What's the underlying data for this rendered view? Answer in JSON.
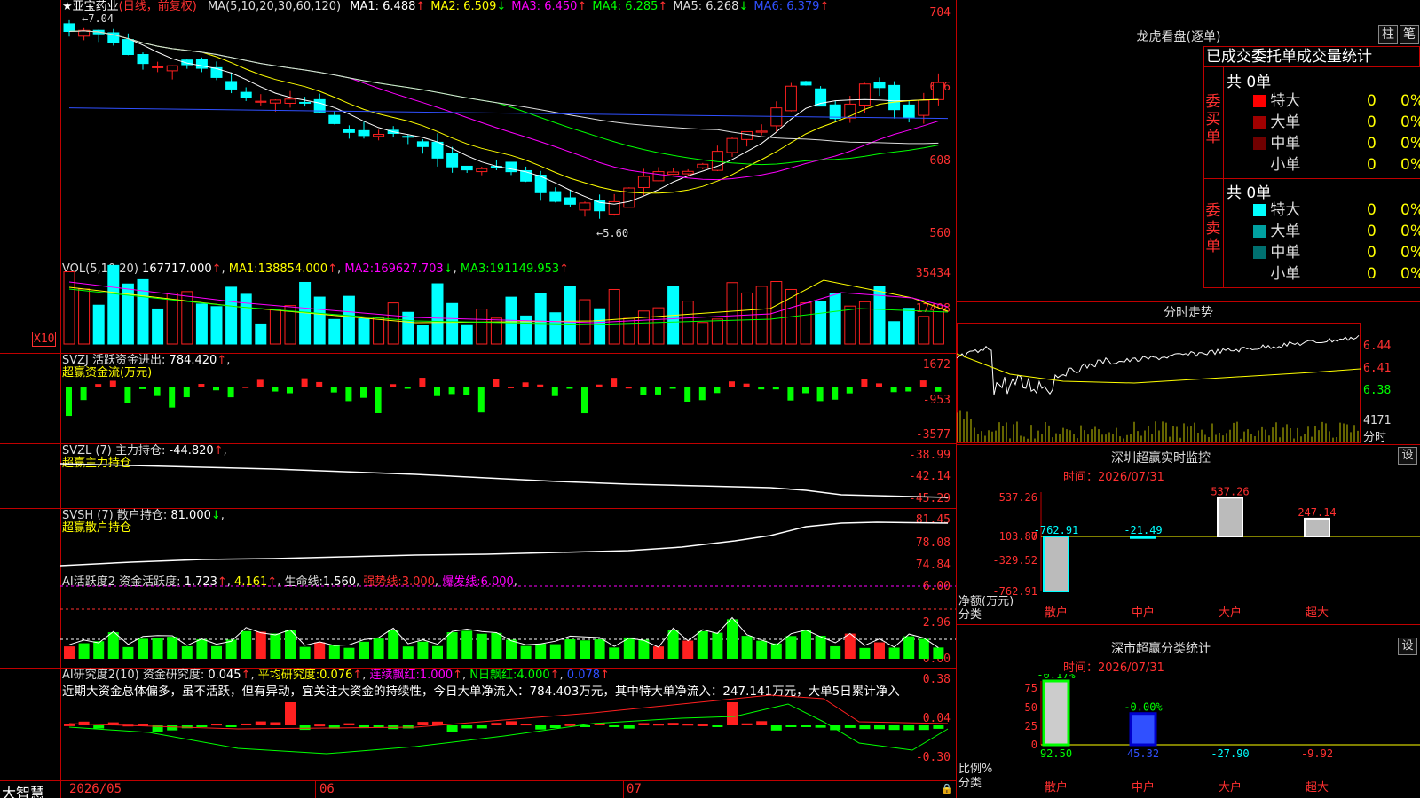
{
  "chart": {
    "title": "★亚宝药业",
    "period": "(日线，前复权)",
    "ma": {
      "params": "MA(5,10,20,30,60,120)",
      "items": [
        {
          "label": "MA1:",
          "value": "6.488",
          "arrow": "↑",
          "color": "#ffffff"
        },
        {
          "label": "MA2:",
          "value": "6.509",
          "arrow": "↓",
          "color": "#ffff00"
        },
        {
          "label": "MA3:",
          "value": "6.450",
          "arrow": "↑",
          "color": "#ff00ff"
        },
        {
          "label": "MA4:",
          "value": "6.285",
          "arrow": "↑",
          "color": "#00ff00"
        },
        {
          "label": "MA5:",
          "value": "6.268",
          "arrow": "↓",
          "color": "#dddddd"
        },
        {
          "label": "MA6:",
          "value": "6.379",
          "arrow": "↑",
          "color": "#3050ff"
        }
      ]
    },
    "price_axis": [
      "704",
      "656",
      "608",
      "560"
    ],
    "high_mark": "←7.04",
    "low_mark": "←5.60",
    "colors": {
      "up": "#ff2020",
      "down": "#00ffff",
      "ma1": "#ffffff",
      "ma2": "#ffff00",
      "ma3": "#ff00ff",
      "ma4": "#00ff00",
      "ma5": "#dddddd",
      "ma6": "#3050ff"
    }
  },
  "vol": {
    "params": "VOL(5,10,20)",
    "value": "167717.000",
    "ma1": {
      "label": "MA1:",
      "value": "138854.000",
      "arrow": "↑"
    },
    "ma2": {
      "label": "MA2:",
      "value": "169627.703",
      "arrow": "↓"
    },
    "ma3": {
      "label": "MA3:",
      "value": "191149.953",
      "arrow": "↑"
    },
    "axis": [
      "35434",
      "17498"
    ],
    "unit": "X10"
  },
  "svzj": {
    "label": "SVZJ 活跃资金进出:",
    "value": "784.420",
    "arrow": "↑",
    "subtitle": "超赢资金流(万元)",
    "axis": [
      "1672",
      "-953",
      "-3577"
    ]
  },
  "svzl": {
    "label": "SVZL (7) 主力持仓:",
    "value": "-44.820",
    "arrow": "↑",
    "subtitle": "超赢主力持仓",
    "axis": [
      "-38.99",
      "-42.14",
      "-45.29"
    ]
  },
  "svsh": {
    "label": "SVSH (7) 散户持仓:",
    "value": "81.000",
    "arrow": "↓",
    "subtitle": "超赢散户持仓",
    "axis": [
      "81.45",
      "78.08",
      "74.84"
    ]
  },
  "ai_active": {
    "label": "AI活跃度2 资金活跃度:",
    "value": "1.723",
    "v2": "4.161",
    "life_label": "生命线:",
    "life_value": "1.560",
    "strong_label": "强势线:",
    "strong_value": "3.000",
    "burst_label": "爆发线:",
    "burst_value": "6.000",
    "axis": [
      "6.00",
      "2.96",
      "0.00"
    ]
  },
  "ai_research": {
    "label": "AI研究度2(10) 资金研究度:",
    "value": "0.045",
    "avg_label": "平均研究度:",
    "avg_value": "0.076",
    "red_label": "连续飘红:",
    "red_value": "1.000",
    "nred_label": "N日飘红:",
    "nred_value": "4.000",
    "v5": "0.078",
    "comment": "近期大资金总体偏多，虽不活跃，但有异动，宜关注大资金的持续性，今日大单净流入：784.403万元，其中特大单净流入：247.141万元，大单5日累计净入",
    "axis": [
      "0.38",
      "0.04",
      "-0.30"
    ]
  },
  "dates": [
    "2026/05",
    "06",
    "07"
  ],
  "brand": "大智慧",
  "right": {
    "dragon": {
      "title": "龙虎看盘(逐单)",
      "btn_bar": "柱",
      "btn_pen": "笔",
      "tabs": "已成交委托单成交量统计",
      "buy_side": "委买单",
      "sell_side": "委卖单",
      "buy_total": "共 0单",
      "sell_total": "共 0单",
      "buy_rows": [
        {
          "name": "特大",
          "count": "0",
          "pct": "0%",
          "color": "#ff0000"
        },
        {
          "name": "大单",
          "count": "0",
          "pct": "0%",
          "color": "#a00000"
        },
        {
          "name": "中单",
          "count": "0",
          "pct": "0%",
          "color": "#700000"
        },
        {
          "name": "小单",
          "count": "0",
          "pct": "0%",
          "color": "#000000"
        }
      ],
      "sell_rows": [
        {
          "name": "特大",
          "count": "0",
          "pct": "0%",
          "color": "#00ffff"
        },
        {
          "name": "大单",
          "count": "0",
          "pct": "0%",
          "color": "#00a0a0"
        },
        {
          "name": "中单",
          "count": "0",
          "pct": "0%",
          "color": "#007070"
        },
        {
          "name": "小单",
          "count": "0",
          "pct": "0%",
          "color": "#000000"
        }
      ]
    },
    "intraday": {
      "title": "分时走势",
      "axis": [
        "6.44",
        "6.41",
        "6.38"
      ],
      "vol_label": "4171",
      "vol_unit": "分时"
    },
    "sz_monitor": {
      "title": "深圳超赢实时监控",
      "gear": "设",
      "time_label": "时间：",
      "time_value": "2026/07/31",
      "axis": [
        "537.26",
        "103.87",
        "0",
        "-329.52",
        "-762.91"
      ],
      "ylabel": "净额(万元)",
      "xlabel": "分类",
      "cats": [
        "散户",
        "中户",
        "大户",
        "超大"
      ],
      "values": [
        "-762.91",
        "-21.49",
        "537.26",
        "247.14"
      ]
    },
    "sz_classify": {
      "title": "深市超赢分类统计",
      "gear": "设",
      "time_label": "时间：",
      "time_value": "2026/07/31",
      "axis": [
        "75",
        "50",
        "25",
        "0"
      ],
      "ylabel": "比例%",
      "xlabel": "分类",
      "cats": [
        "散户",
        "中户",
        "大户",
        "超大"
      ],
      "top_values": [
        "-0.17%",
        "-0.00%"
      ],
      "values": [
        "92.50",
        "45.32",
        "-27.90",
        "-9.92"
      ]
    }
  }
}
